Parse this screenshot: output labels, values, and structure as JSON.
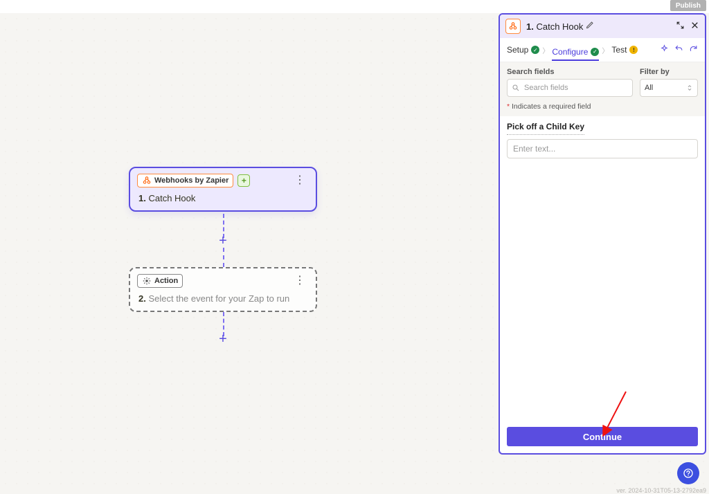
{
  "topbar": {
    "publish": "Publish"
  },
  "nodes": {
    "trigger": {
      "chip": "Webhooks by Zapier",
      "step_no": "1.",
      "title": "Catch Hook"
    },
    "action": {
      "chip": "Action",
      "step_no": "2.",
      "title": "Select the event for your Zap to run"
    }
  },
  "panel": {
    "step_no": "1.",
    "title": "Catch Hook",
    "tabs": {
      "setup": "Setup",
      "configure": "Configure",
      "test": "Test"
    },
    "search_fields_label": "Search fields",
    "search_placeholder": "Search fields",
    "filter_label": "Filter by",
    "filter_value": "All",
    "required_note": "Indicates a required field",
    "field_label": "Pick off a Child Key",
    "field_placeholder": "Enter text...",
    "continue": "Continue"
  },
  "footer": {
    "version": "ver. 2024-10-31T05-13-2792ea9"
  }
}
